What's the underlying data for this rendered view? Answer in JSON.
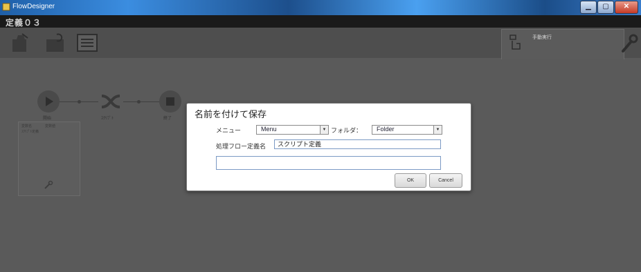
{
  "window": {
    "title": "FlowDesigner"
  },
  "document": {
    "title": "定義０３"
  },
  "run_panel": {
    "label": "手動実行"
  },
  "flow": {
    "nodes": [
      {
        "label": "開始"
      },
      {
        "label": "ｽｸﾘﾌﾟﾄ"
      },
      {
        "label": "終了"
      }
    ],
    "panel_headers": [
      "変数名",
      "変数値"
    ],
    "panel_sub": "ｽｸﾘﾌﾟﾄ定義"
  },
  "dialog": {
    "title": "名前を付けて保存",
    "menu_label": "メニュー",
    "menu_value": "Menu",
    "folder_label": "フォルダ：",
    "folder_value": "Folder",
    "name_label": "処理フロー定義名",
    "name_value": "スクリプト定義",
    "description_value": "",
    "ok_label": "OK",
    "cancel_label": "Cancel"
  },
  "colors": {
    "titlebar": "#1f5fa8",
    "dialog_bg": "#ffffff",
    "canvas_bg": "#5a5a5a"
  }
}
